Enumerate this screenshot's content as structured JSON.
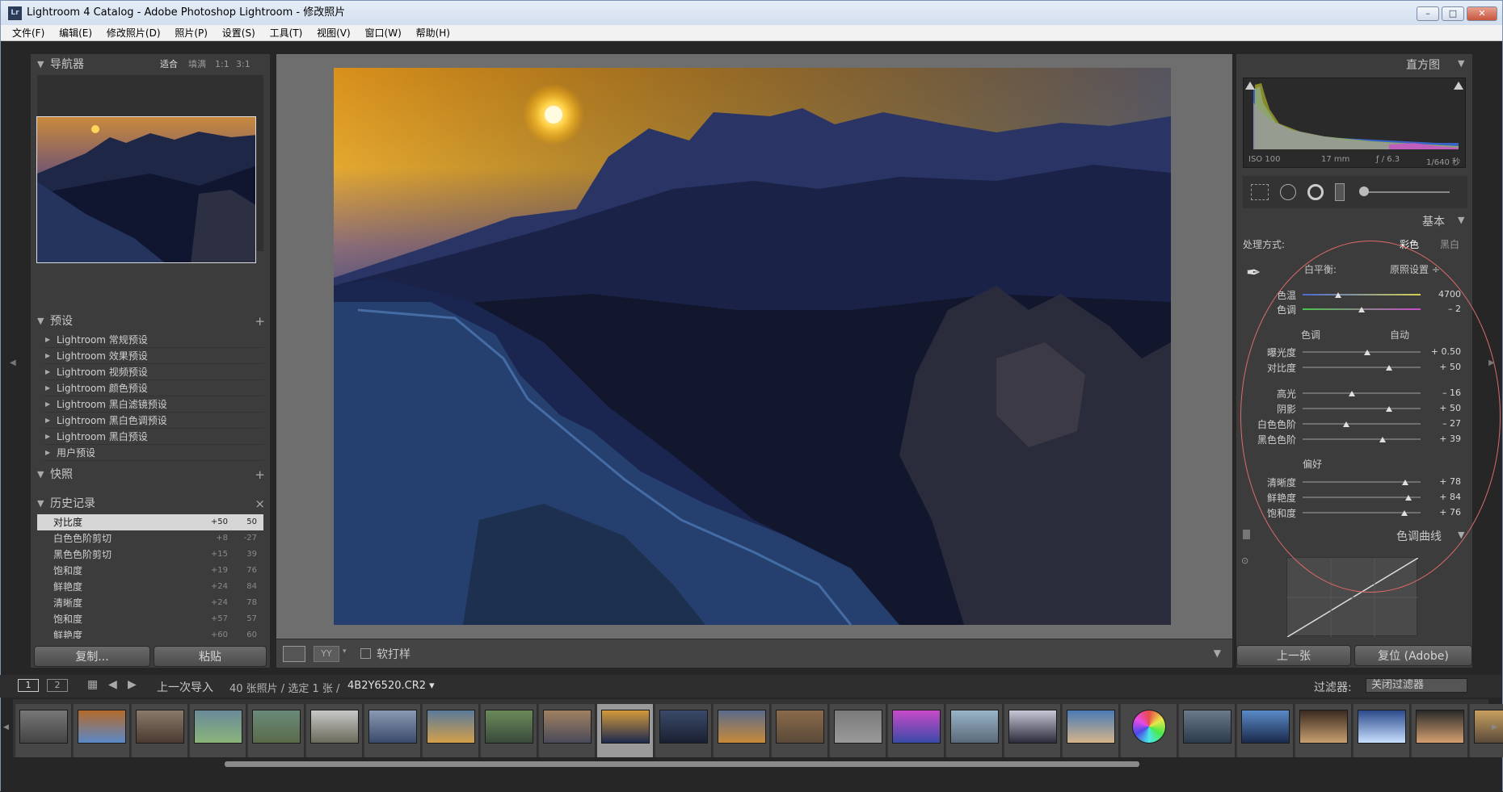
{
  "window": {
    "title": "Lightroom 4 Catalog - Adobe Photoshop Lightroom - 修改照片",
    "app_icon": "Lr",
    "min": "–",
    "max": "□",
    "close": "✕"
  },
  "menu": [
    "文件(F)",
    "编辑(E)",
    "修改照片(D)",
    "照片(P)",
    "设置(S)",
    "工具(T)",
    "视图(V)",
    "窗口(W)",
    "帮助(H)"
  ],
  "navigator": {
    "title": "导航器",
    "zoom": [
      "适合",
      "填满",
      "1:1",
      "3:1"
    ]
  },
  "presets": {
    "title": "预设",
    "items": [
      "Lightroom 常规预设",
      "Lightroom 效果预设",
      "Lightroom 视频预设",
      "Lightroom 颜色预设",
      "Lightroom 黑白滤镜预设",
      "Lightroom 黑白色调预设",
      "Lightroom 黑白预设",
      "用户预设"
    ]
  },
  "snapshots": {
    "title": "快照"
  },
  "history": {
    "title": "历史记录",
    "items": [
      {
        "name": "对比度",
        "delta": "+50",
        "value": "50"
      },
      {
        "name": "白色色阶剪切",
        "delta": "+8",
        "value": "-27"
      },
      {
        "name": "黑色色阶剪切",
        "delta": "+15",
        "value": "39"
      },
      {
        "name": "饱和度",
        "delta": "+19",
        "value": "76"
      },
      {
        "name": "鲜艳度",
        "delta": "+24",
        "value": "84"
      },
      {
        "name": "清晰度",
        "delta": "+24",
        "value": "78"
      },
      {
        "name": "饱和度",
        "delta": "+57",
        "value": "57"
      },
      {
        "name": "鲜艳度",
        "delta": "+60",
        "value": "60"
      }
    ]
  },
  "left_buttons": {
    "copy": "复制...",
    "paste": "粘贴"
  },
  "toolbar": {
    "softproof": "软打样",
    "yy": "YY"
  },
  "right_panel": {
    "histogram_title": "直方图",
    "exif": {
      "iso": "ISO 100",
      "focal": "17 mm",
      "aperture": "ƒ / 6.3",
      "shutter": "1/640 秒"
    },
    "basic_title": "基本",
    "treatment_label": "处理方式:",
    "treatment_color": "彩色",
    "treatment_bw": "黑白",
    "wb_label": "白平衡:",
    "wb_value": "原照设置 ÷",
    "temp": {
      "label": "色温",
      "value": "4700",
      "pos": 0.3
    },
    "tint": {
      "label": "色调",
      "value": "– 2",
      "pos": 0.5
    },
    "tone_label": "色调",
    "auto": "自动",
    "sliders": [
      {
        "label": "曝光度",
        "value": "+ 0.50",
        "pos": 0.55
      },
      {
        "label": "对比度",
        "value": "+ 50",
        "pos": 0.73
      },
      {
        "label": "高光",
        "value": "– 16",
        "pos": 0.42
      },
      {
        "label": "阴影",
        "value": "+ 50",
        "pos": 0.73
      },
      {
        "label": "白色色阶",
        "value": "– 27",
        "pos": 0.37
      },
      {
        "label": "黑色色阶",
        "value": "+ 39",
        "pos": 0.68
      }
    ],
    "presence_label": "偏好",
    "presence": [
      {
        "label": "清晰度",
        "value": "+ 78",
        "pos": 0.87
      },
      {
        "label": "鲜艳度",
        "value": "+ 84",
        "pos": 0.9
      },
      {
        "label": "饱和度",
        "value": "+ 76",
        "pos": 0.86
      }
    ],
    "tonecurve_title": "色调曲线",
    "prev_btn": "上一张",
    "reset_btn": "复位 (Adobe)"
  },
  "filmbar": {
    "screen1": "1",
    "screen2": "2",
    "source": "上一次导入",
    "count": "40 张照片 / 选定 1 张 /",
    "filename": "4B2Y6520.CR2 ▾",
    "filter_label": "过滤器:",
    "filter_value": "关闭过滤器"
  },
  "colors": {
    "accent": "#e06a6a",
    "panel": "#3c3c3c"
  }
}
